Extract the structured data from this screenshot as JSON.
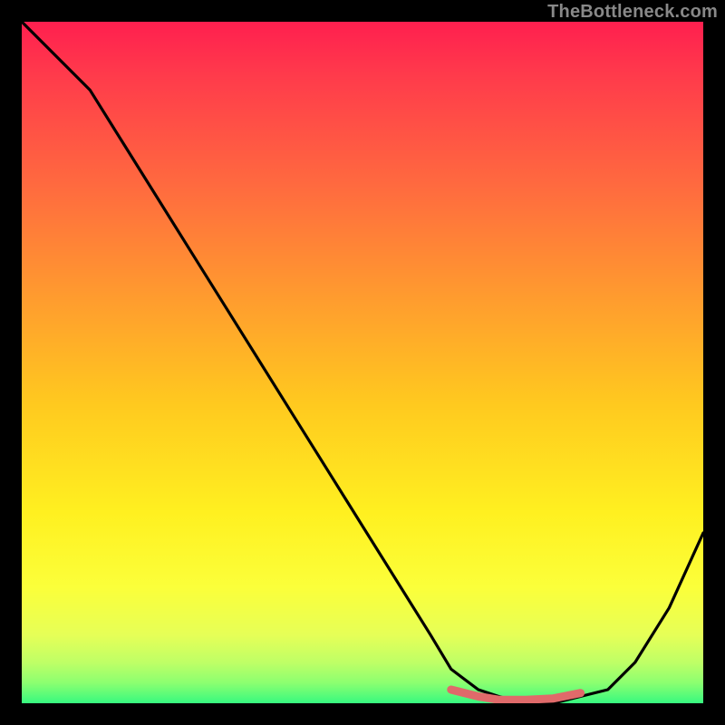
{
  "watermark": "TheBottleneck.com",
  "chart_data": {
    "type": "line",
    "title": "",
    "xlabel": "",
    "ylabel": "",
    "ylim": [
      0,
      100
    ],
    "xlim": [
      0,
      100
    ],
    "series": [
      {
        "name": "bottleneck-curve",
        "x": [
          0,
          5,
          10,
          15,
          20,
          25,
          30,
          35,
          40,
          45,
          50,
          55,
          60,
          63,
          67,
          70,
          74,
          78,
          82,
          86,
          90,
          95,
          100
        ],
        "y": [
          100,
          95,
          90,
          82,
          74,
          66,
          58,
          50,
          42,
          34,
          26,
          18,
          10,
          5,
          2,
          1,
          0,
          0,
          1,
          2,
          6,
          14,
          25
        ]
      },
      {
        "name": "optimal-zone-marker",
        "x": [
          63,
          67,
          70,
          74,
          78,
          82
        ],
        "y": [
          2,
          1,
          0.5,
          0.5,
          0.7,
          1.5
        ]
      }
    ],
    "background_gradient": {
      "top": "#ff1f4f",
      "mid1": "#ff9a2f",
      "mid2": "#fff020",
      "bottom": "#37f97f"
    },
    "annotations": []
  }
}
